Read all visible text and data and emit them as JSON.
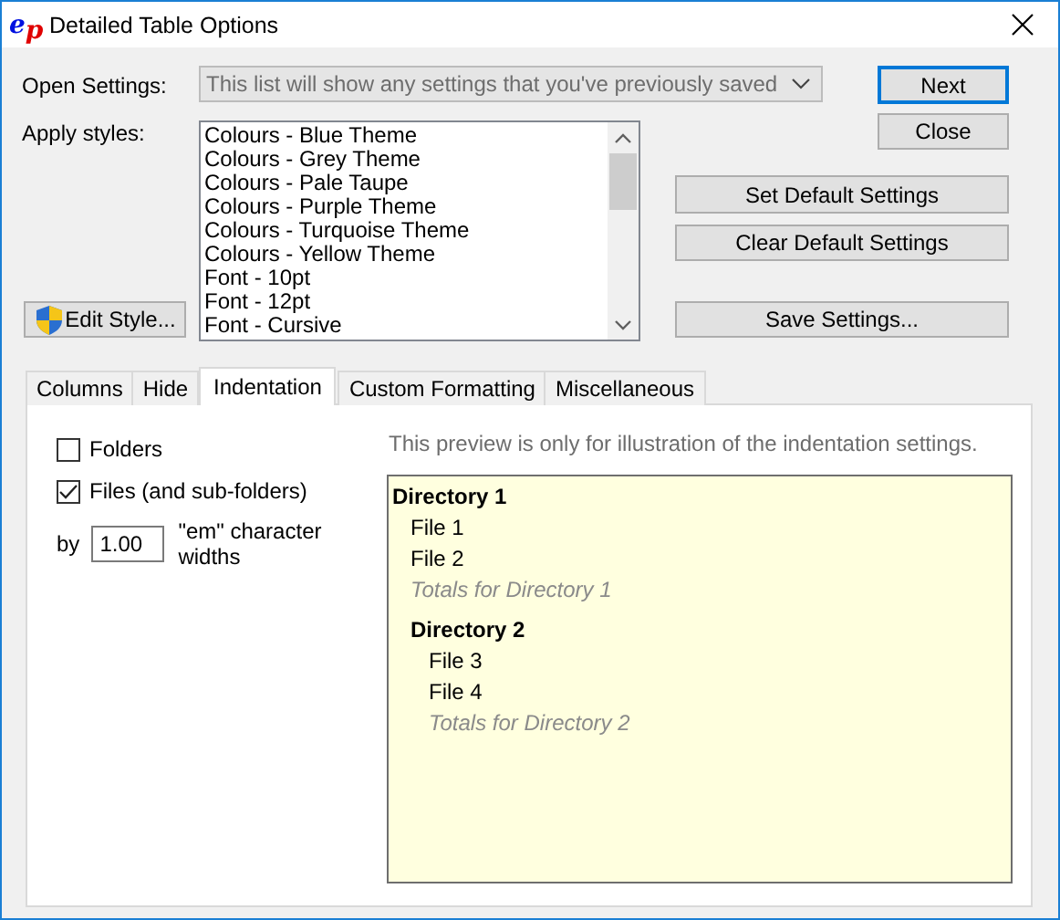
{
  "window": {
    "logo": [
      "e",
      "p"
    ],
    "title": "Detailed Table Options"
  },
  "open_settings": {
    "label": "Open Settings:",
    "value": "This list will show any settings that you've previously saved",
    "disabled": true
  },
  "dialog_buttons": [
    {
      "label": "Next",
      "default": true
    },
    {
      "label": "Close",
      "default": false
    }
  ],
  "apply_styles": {
    "label": "Apply styles:",
    "items": [
      "Colours - Blue Theme",
      "Colours - Grey Theme",
      "Colours - Pale Taupe",
      "Colours - Purple Theme",
      "Colours - Turquoise Theme",
      "Colours - Yellow Theme",
      "Font - 10pt",
      "Font - 12pt",
      "Font - Cursive"
    ]
  },
  "edit_style_button": {
    "label": "Edit Style..."
  },
  "settings_buttons": [
    {
      "label": "Set Default Settings"
    },
    {
      "label": "Clear Default Settings"
    },
    {
      "label": "Save Settings..."
    }
  ],
  "tabs": [
    {
      "label": "Columns",
      "selected": false
    },
    {
      "label": "Hide",
      "selected": false
    },
    {
      "label": "Indentation",
      "selected": true
    },
    {
      "label": "Custom Formatting",
      "selected": false
    },
    {
      "label": "Miscellaneous",
      "selected": false
    }
  ],
  "indent_options": [
    {
      "label": "Folders",
      "checked": false
    },
    {
      "label": "Files (and sub-folders)",
      "checked": true
    }
  ],
  "indent_amount": {
    "prefix": "by",
    "value": "1.00",
    "suffix": "\"em\" character widths"
  },
  "preview": {
    "note": "This preview is only for illustration of the indentation settings.",
    "items": [
      {
        "kind": "directory",
        "label": "Directory 1",
        "children": [
          {
            "kind": "file",
            "label": "File 1"
          },
          {
            "kind": "file",
            "label": "File 2"
          },
          {
            "kind": "totals",
            "label": "Totals for Directory 1"
          },
          {
            "kind": "directory",
            "label": "Directory 2",
            "children": [
              {
                "kind": "file",
                "label": "File 3"
              },
              {
                "kind": "file",
                "label": "File 4"
              },
              {
                "kind": "totals",
                "label": "Totals for Directory 2"
              }
            ]
          }
        ]
      }
    ]
  }
}
